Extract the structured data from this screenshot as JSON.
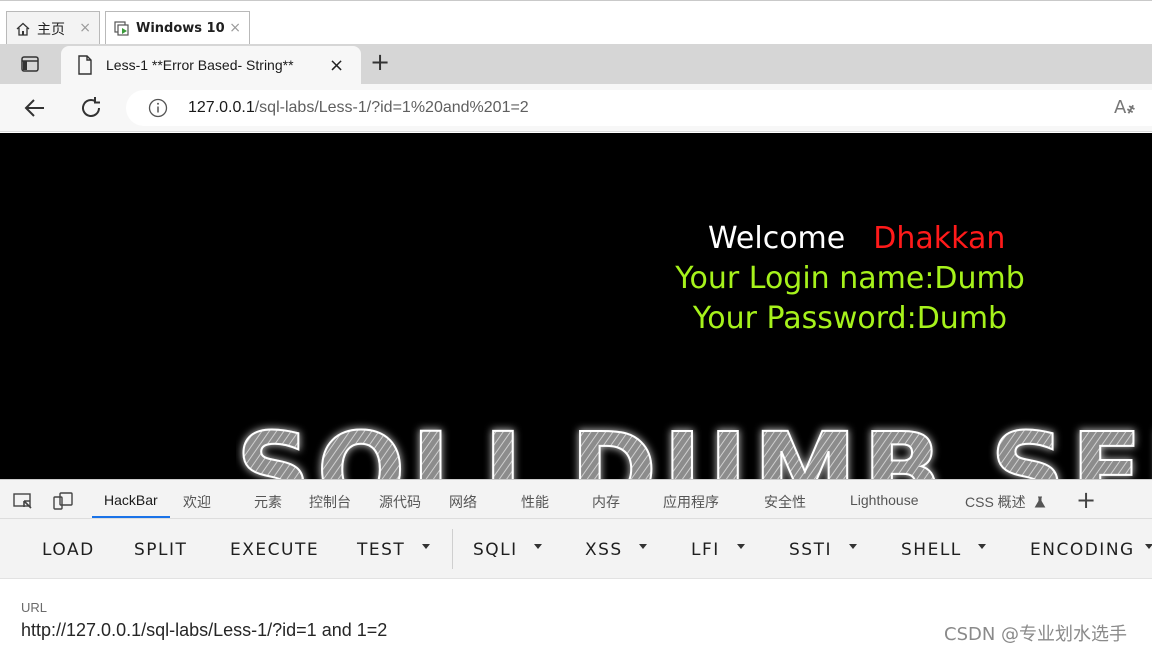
{
  "vm_tabs": [
    {
      "label": "主页",
      "close": "×"
    },
    {
      "label": "Windows 10",
      "close": "×"
    }
  ],
  "browser": {
    "tab_title": "Less-1 **Error Based- String**",
    "tab_close": "×",
    "new_tab": "+",
    "url_host": "127.0.0.1",
    "url_path": "/sql-labs/Less-1/?id=1%20and%201=2",
    "read_aloud": "A҂"
  },
  "page": {
    "welcome": "Welcome",
    "user": "Dhakkan",
    "login_line": "Your Login name:Dumb",
    "password_line": "Your Password:Dumb",
    "banner_text": "SQLI DUMB SER"
  },
  "devtools": {
    "tabs": [
      "HackBar",
      "欢迎",
      "元素",
      "控制台",
      "源代码",
      "网络",
      "性能",
      "内存",
      "应用程序",
      "安全性",
      "Lighthouse",
      "CSS 概述"
    ],
    "add": "+"
  },
  "hackbar": {
    "buttons": [
      "LOAD",
      "SPLIT",
      "EXECUTE",
      "TEST",
      "SQLI",
      "XSS",
      "LFI",
      "SSTI",
      "SHELL",
      "ENCODING"
    ]
  },
  "url_field": {
    "label": "URL",
    "value": "http://127.0.0.1/sql-labs/Less-1/?id=1 and 1=2"
  },
  "watermark": "CSDN @专业划水选手",
  "colors": {
    "welcome": "#ffffff",
    "user": "#ff1a1a",
    "credentials": "#a6f21b",
    "active_tab_underline": "#1a73e8"
  }
}
